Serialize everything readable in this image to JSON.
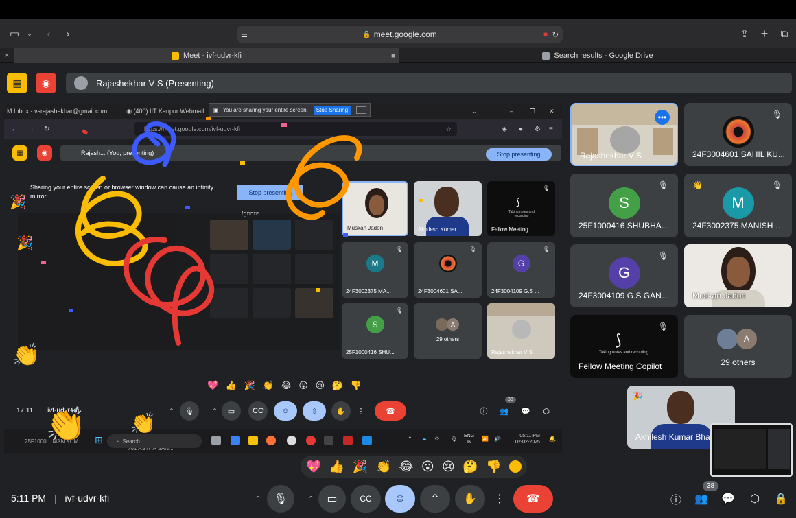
{
  "browser": {
    "url": "meet.google.com",
    "tabs": [
      {
        "label": "Meet - ivf-udvr-kfi"
      },
      {
        "label": "Search results - Google Drive"
      }
    ]
  },
  "meet": {
    "presenting_label": "Rajashekhar V S (Presenting)",
    "meeting_time": "5:11 PM",
    "meeting_code": "ivf-udvr-kfi",
    "participant_count": "38",
    "tiles": [
      {
        "name": "Rajashekhar V S"
      },
      {
        "name": "24F3004601 SAHIL KU..."
      },
      {
        "name": "25F1000416 SHUBHAM...",
        "initial": "S"
      },
      {
        "name": "24F3002375 MANISH K...",
        "initial": "M"
      },
      {
        "name": "24F3004109 G.S GANE...",
        "initial": "G"
      },
      {
        "name": "Muskan Jadon"
      },
      {
        "name": "Fellow Meeting Copilot",
        "note": "Taking notes and recording"
      },
      {
        "name": "29 others",
        "initial": "A"
      },
      {
        "name": "Akhilesh Kumar Bha..."
      }
    ],
    "reactions": [
      "💖",
      "👍",
      "🎉",
      "👏",
      "😂",
      "😮",
      "😢",
      "🤔",
      "👎"
    ],
    "colors": {
      "end_call": "#ea4335",
      "active_button": "#a8c7fa",
      "accent": "#8ab4f8"
    }
  },
  "shared_screen": {
    "browser_tabs": [
      "Inbox - vsrajashekhar@gmail.com",
      "(400) IIT Kanpur Webmail :: II"
    ],
    "share_notice": "You are sharing your entire screen.",
    "share_stop": "Stop Sharing",
    "share_minimize": "_",
    "url": "https://meet.google.com/ivf-udvr-kfi",
    "present_bar": "Rajash... (You, presenting)",
    "stop_presenting": "Stop presenting",
    "warning": "Sharing your entire screen or browser window can cause an infinity mirror",
    "stop_presenting2": "Stop presenting",
    "ignore": "Ignore",
    "time": "17:11",
    "code": "ivf-udvr-kfi",
    "count": "38",
    "tiles": [
      {
        "name": "Muskan Jadon"
      },
      {
        "name": "Akhilesh Kumar ..."
      },
      {
        "name": "Fellow Meeting ...",
        "note": "Taking notes and recording"
      },
      {
        "name": "24F3002375 MA...",
        "initial": "M"
      },
      {
        "name": "24F3004601 SA..."
      },
      {
        "name": "24F3004109 G.S ...",
        "initial": "G"
      },
      {
        "name": "25F1000416 SHU...",
        "initial": "S"
      },
      {
        "name": "29 others",
        "initial": "A"
      },
      {
        "name": "Rajashekhar V S"
      }
    ],
    "taskbar": {
      "search": "Search",
      "lang": "ENG",
      "region": "IN",
      "time": "05:11 PM",
      "date": "02-02-2025",
      "under_left": "25F1000... MAN KUM...",
      "under_mid": "761 ASTHA SAN..."
    }
  }
}
